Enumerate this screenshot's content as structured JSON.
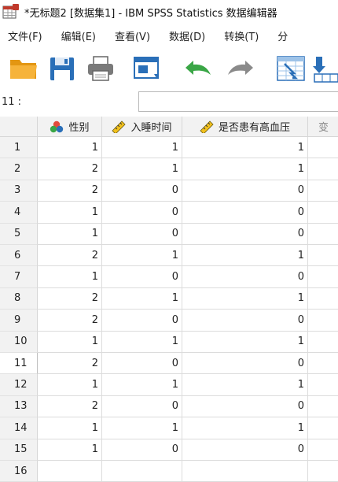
{
  "window": {
    "title": "*无标题2 [数据集1] - IBM SPSS Statistics 数据编辑器",
    "app_icon": "spss-data-editor-icon"
  },
  "menu": [
    "文件(F)",
    "编辑(E)",
    "查看(V)",
    "数据(D)",
    "转换(T)",
    "分"
  ],
  "toolbar": [
    {
      "name": "open-folder-icon",
      "color": "#f0a21c"
    },
    {
      "name": "save-floppy-icon",
      "color": "#2a6fb8"
    },
    {
      "name": "print-icon",
      "color": "#6a6a6a"
    },
    {
      "name": "dialog-recall-icon",
      "color": "#2a6fb8"
    },
    {
      "name": "undo-icon",
      "color": "#3aa646"
    },
    {
      "name": "redo-icon",
      "color": "#8a8a8a"
    },
    {
      "name": "go-to-case-icon",
      "color": "#2a6fb8"
    },
    {
      "name": "go-to-variable-icon",
      "color": "#2a6fb8"
    }
  ],
  "cell_editor": {
    "ref": "11 :",
    "value": ""
  },
  "columns": [
    {
      "label": "性别",
      "icon": "nominal-measure-icon"
    },
    {
      "label": "入睡时间",
      "icon": "scale-ruler-icon"
    },
    {
      "label": "是否患有高血压",
      "icon": "scale-ruler-icon"
    },
    {
      "label": "变",
      "icon": ""
    }
  ],
  "rows": [
    {
      "n": "1",
      "v": [
        "1",
        "1",
        "1"
      ]
    },
    {
      "n": "2",
      "v": [
        "2",
        "1",
        "1"
      ]
    },
    {
      "n": "3",
      "v": [
        "2",
        "0",
        "0"
      ]
    },
    {
      "n": "4",
      "v": [
        "1",
        "0",
        "0"
      ]
    },
    {
      "n": "5",
      "v": [
        "1",
        "0",
        "0"
      ]
    },
    {
      "n": "6",
      "v": [
        "2",
        "1",
        "1"
      ]
    },
    {
      "n": "7",
      "v": [
        "1",
        "0",
        "0"
      ]
    },
    {
      "n": "8",
      "v": [
        "2",
        "1",
        "1"
      ]
    },
    {
      "n": "9",
      "v": [
        "2",
        "0",
        "0"
      ]
    },
    {
      "n": "10",
      "v": [
        "1",
        "1",
        "1"
      ]
    },
    {
      "n": "11",
      "v": [
        "2",
        "0",
        "0"
      ]
    },
    {
      "n": "12",
      "v": [
        "1",
        "1",
        "1"
      ]
    },
    {
      "n": "13",
      "v": [
        "2",
        "0",
        "0"
      ]
    },
    {
      "n": "14",
      "v": [
        "1",
        "1",
        "1"
      ]
    },
    {
      "n": "15",
      "v": [
        "1",
        "0",
        "0"
      ]
    },
    {
      "n": "16",
      "v": [
        "",
        "",
        ""
      ]
    }
  ],
  "selected_row": "11"
}
